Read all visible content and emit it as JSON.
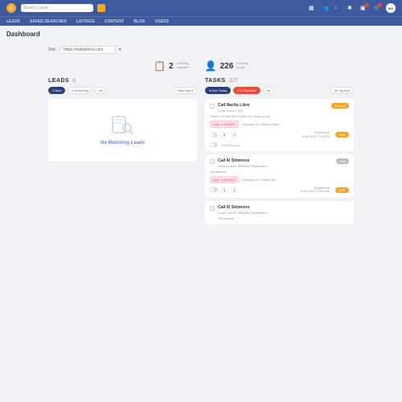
{
  "header": {
    "search_placeholder": "Search Leads",
    "avatar": "MN"
  },
  "nav": {
    "items": [
      "LEADS",
      "SAVED SEARCHES",
      "LISTINGS",
      "CONTENT",
      "BLOG",
      "USERS"
    ]
  },
  "page": {
    "title": "Dashboard"
  },
  "site": {
    "label": "Site:",
    "value": "https://realtyidxny.com"
  },
  "stats": {
    "inquiries": {
      "value": "2",
      "label1": "Pending",
      "label2": "Inquiries"
    },
    "leads": {
      "value": "226",
      "label1": "Pending",
      "label2": "Leads"
    }
  },
  "leads": {
    "title": "LEADS",
    "count": "0",
    "filters": [
      "4 New",
      "4 Returning",
      "All"
    ],
    "sort": "Past Day ▾",
    "empty": "No Matching Leads"
  },
  "tasks": {
    "title": "TASKS",
    "count": "227",
    "filters": [
      "4 Due Today",
      "222 Overdue",
      "All"
    ],
    "type": "All Types ▾",
    "items": [
      {
        "title": "Call Nacho Libre",
        "source": "Lead Source: IDX",
        "badge": "Primary",
        "badgeClass": "orange",
        "note": "Reach out and see if they are ready to buy.",
        "due": "Due: 9-14-2022",
        "assigned": "Assigned To: Nacho Mster",
        "price1": "$",
        "price2": "$",
        "reg1": "Registered",
        "reg2": "9-05-2022 7:45 PM",
        "edit": "Edit",
        "source2": "Lead Source:"
      },
      {
        "title": "Call Al Simmons",
        "source": "Lead Source: Website Registration",
        "badge": "New",
        "badgeClass": "gray",
        "note": "1st Attempt",
        "due": "Due: 9-20-2022",
        "assigned": "Assigned To: Phillip Gill",
        "price1": "$",
        "price2": "$",
        "reg1": "Registered",
        "reg2": "9-05-2022 12:51 AM",
        "edit": "Edit"
      },
      {
        "title": "Call Al Simmons",
        "source": "Lead Source: Website Registration",
        "note": "1st Attempt"
      }
    ]
  }
}
